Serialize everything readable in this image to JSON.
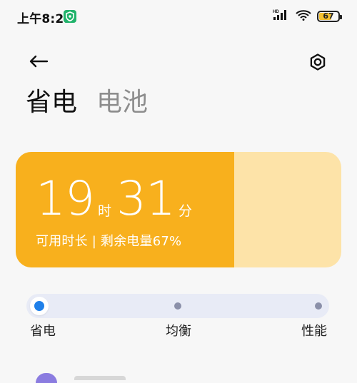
{
  "status_bar": {
    "time": "上午8:21",
    "network_label": "HD",
    "battery_percent": 67,
    "battery_text": "67",
    "battery_color": "#f5c12f",
    "shield_color": "#21b36b"
  },
  "header": {
    "back_icon": "arrow-left-icon",
    "settings_icon": "gear-icon"
  },
  "title": {
    "active": "省电",
    "inactive": "电池"
  },
  "battery_card": {
    "hours": "19",
    "hour_unit": "时",
    "minutes": "31",
    "minute_unit": "分",
    "subtitle": "可用时长 | 剩余电量67%",
    "remaining_percent": 67,
    "fill_color": "#f8b01d",
    "track_color": "#fde3a8"
  },
  "mode_slider": {
    "selected_index": 0,
    "options": [
      "省电",
      "均衡",
      "性能"
    ],
    "accent": "#1f7fe9",
    "track_color": "#e8ebf6"
  }
}
